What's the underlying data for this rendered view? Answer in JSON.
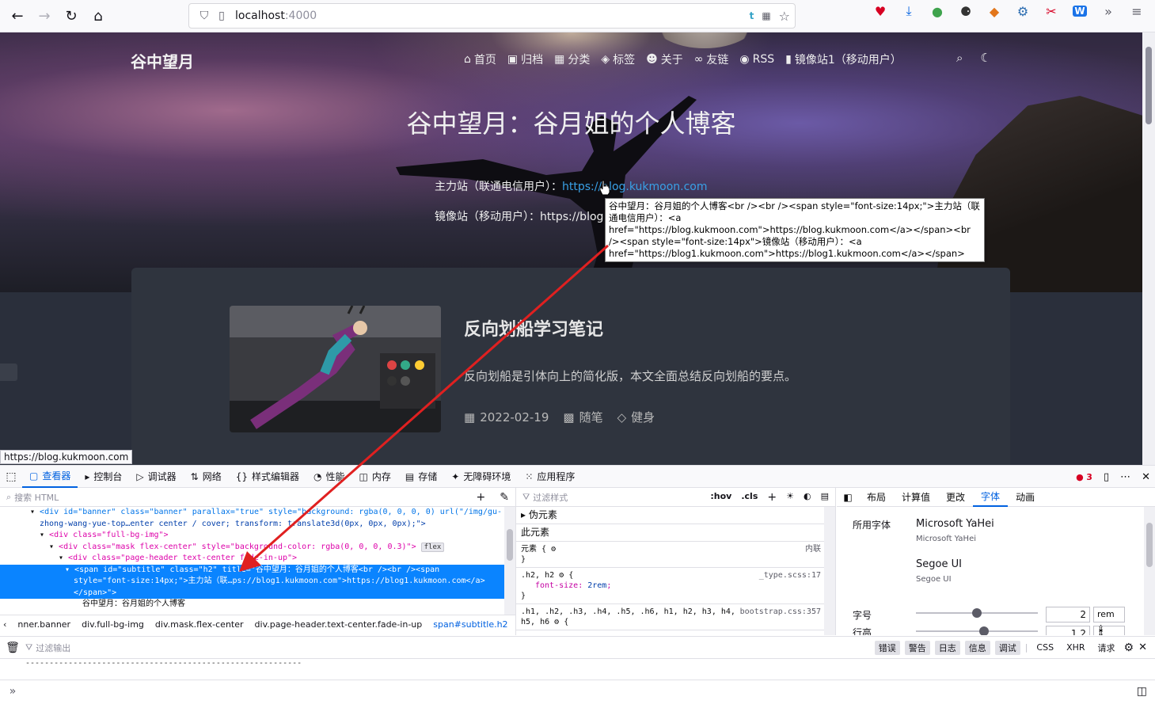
{
  "browser": {
    "url_host": "localhost",
    "url_port": ":4000",
    "status_url": "https://blog.kukmoon.com"
  },
  "site": {
    "brand": "谷中望月",
    "nav": [
      {
        "icon": "home-icon",
        "glyph": "⌂",
        "label": "首页"
      },
      {
        "icon": "archive-icon",
        "glyph": "▣",
        "label": "归档"
      },
      {
        "icon": "grid-icon",
        "glyph": "▦",
        "label": "分类"
      },
      {
        "icon": "tags-icon",
        "glyph": "◈",
        "label": "标签"
      },
      {
        "icon": "user-icon",
        "glyph": "☻",
        "label": "关于"
      },
      {
        "icon": "link-icon",
        "glyph": "∞",
        "label": "友链"
      },
      {
        "icon": "rss-icon",
        "glyph": "◉",
        "label": "RSS"
      },
      {
        "icon": "book-icon",
        "glyph": "▮",
        "label": "镜像站1（移动用户）"
      }
    ],
    "title": "谷中望月：谷月姐的个人博客",
    "sub1_label": "主力站（联通电信用户）：",
    "sub1_link": "https://blog.kukmoon.com",
    "sub2_label": "镜像站（移动用户）：",
    "sub2_link": "https://blog",
    "tooltip": "谷中望月：谷月姐的个人博客<br /><br /><span style=\"font-size:14px;\">主力站（联通电信用户）：<a href=\"https://blog.kukmoon.com\">https://blog.kukmoon.com</a></span><br /><span style=\"font-size:14px\">镜像站（移动用户）：<a href=\"https://blog1.kukmoon.com\">https://blog1.kukmoon.com</a></span>"
  },
  "post": {
    "title": "反向划船学习笔记",
    "desc": "反向划船是引体向上的简化版，本文全面总结反向划船的要点。",
    "date": "2022-02-19",
    "category": "随笔",
    "tag": "健身"
  },
  "devtools": {
    "tabs": [
      {
        "icon": "inspector-icon",
        "glyph": "▢",
        "label": "查看器",
        "active": true
      },
      {
        "icon": "console-icon",
        "glyph": "▸",
        "label": "控制台"
      },
      {
        "icon": "debugger-icon",
        "glyph": "▷",
        "label": "调试器"
      },
      {
        "icon": "network-icon",
        "glyph": "⇅",
        "label": "网络"
      },
      {
        "icon": "style-editor-icon",
        "glyph": "{}",
        "label": "样式编辑器"
      },
      {
        "icon": "performance-icon",
        "glyph": "◔",
        "label": "性能"
      },
      {
        "icon": "memory-icon",
        "glyph": "◫",
        "label": "内存"
      },
      {
        "icon": "storage-icon",
        "glyph": "▤",
        "label": "存储"
      },
      {
        "icon": "accessibility-icon",
        "glyph": "✦",
        "label": "无障碍环境"
      },
      {
        "icon": "application-icon",
        "glyph": "⁙",
        "label": "应用程序"
      }
    ],
    "error_count": "3",
    "search_html_placeholder": "搜索 HTML",
    "markup_lines": [
      "<div id=\"banner\" class=\"banner\" parallax=\"true\" style=\"background: rgba(0, 0, 0, 0) url(\"/img/gu-",
      "zhong-wang-yue-top…enter center / cover; transform: translate3d(0px, 0px, 0px);\">",
      "<div class=\"full-bg-img\">",
      "<div class=\"mask flex-center\" style=\"background-color: rgba(0, 0, 0, 0.3)\">",
      "<div class=\"page-header text-center fade-in-up\">",
      "<span id=\"subtitle\" class=\"h2\" title=\"谷中望月：谷月姐的个人博客<br /><br /><span",
      "style=\"font-size:14px;\">主力站（联…ps://blog1.kukmoon.com\">https://blog1.kukmoon.com</a>",
      "</span>\">",
      "谷中望月：谷月姐的个人博客"
    ],
    "flex_badge": "flex",
    "breadcrumbs": [
      "nner.banner",
      "div.full-bg-img",
      "div.mask.flex-center",
      "div.page-header.text-center.fade-in-up",
      "span#subtitle.h2"
    ],
    "rules_filter_placeholder": "过滤样式",
    "rules_buttons": [
      ":hov",
      ".cls"
    ],
    "pseudo_label": "伪元素",
    "this_element_label": "此元素",
    "element_rule": "元素 {",
    "element_rule_src": "内联",
    "h2_selector": ".h2, h2",
    "h2_src": "_type.scss:17",
    "h2_prop": "font-size",
    "h2_val": "2rem",
    "h_selector": ".h1, .h2, .h3, .h4, .h5, .h6, h1, h2, h3, h4,",
    "h_selector2": "h5, h6",
    "h_src": "bootstrap.css:357",
    "font_tabs": [
      "布局",
      "计算值",
      "更改",
      "字体",
      "动画"
    ],
    "fonts_used_label": "所用字体",
    "font1_name": "Microsoft YaHei",
    "font1_sub": "Microsoft YaHei",
    "font2_name": "Segoe UI",
    "font2_sub": "Segoe UI",
    "size_label": "字号",
    "size_value": "2",
    "size_unit": "rem",
    "size_slider_level": 0.5,
    "line_label": "行高",
    "line_value": "1.2",
    "console_filter_placeholder": "过滤输出",
    "console_levels": [
      "错误",
      "警告",
      "日志",
      "信息",
      "调试"
    ],
    "console_extra": [
      "CSS",
      "XHR",
      "请求"
    ],
    "console_dashes": "----------------------------------------------------------",
    "console_prompt": "»"
  }
}
